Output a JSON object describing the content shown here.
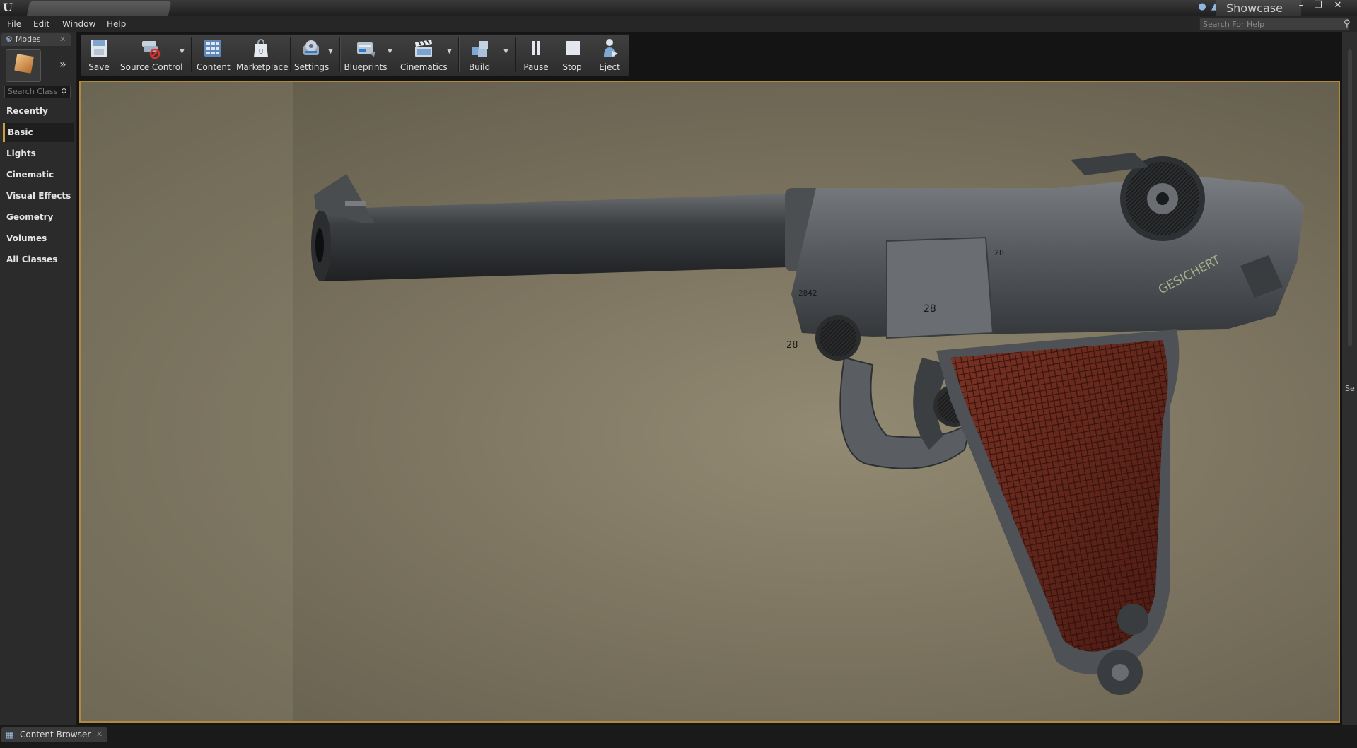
{
  "titlebar": {
    "project_name": "Showcase",
    "logo_text": "U"
  },
  "menu": {
    "items": [
      "File",
      "Edit",
      "Window",
      "Help"
    ]
  },
  "help_search": {
    "placeholder": "Search For Help"
  },
  "modes": {
    "tab_label": "Modes",
    "search_placeholder": "Search Class",
    "categories": [
      "Recently Placed",
      "Basic",
      "Lights",
      "Cinematic",
      "Visual Effects",
      "Geometry",
      "Volumes",
      "All Classes"
    ],
    "active_category": "Basic"
  },
  "toolbar": {
    "save": "Save",
    "source_control": "Source Control",
    "content": "Content",
    "marketplace": "Marketplace",
    "settings": "Settings",
    "blueprints": "Blueprints",
    "cinematics": "Cinematics",
    "build": "Build",
    "pause": "Pause",
    "stop": "Stop",
    "eject": "Eject"
  },
  "viewport": {
    "engraving_safety": "GESICHERT",
    "serial_barrel": "2842",
    "stamp_frame": "28",
    "stamp_toggle": "28",
    "stamp_sear": "28"
  },
  "right_panel": {
    "truncated_label": "Se"
  },
  "bottom": {
    "content_browser_tab": "Content Browser"
  },
  "colors": {
    "viewport_border": "#b08a3a",
    "active_category_accent": "#c8a040",
    "grip_wood": "#6a2a1e",
    "metal": "#5a5d60"
  }
}
